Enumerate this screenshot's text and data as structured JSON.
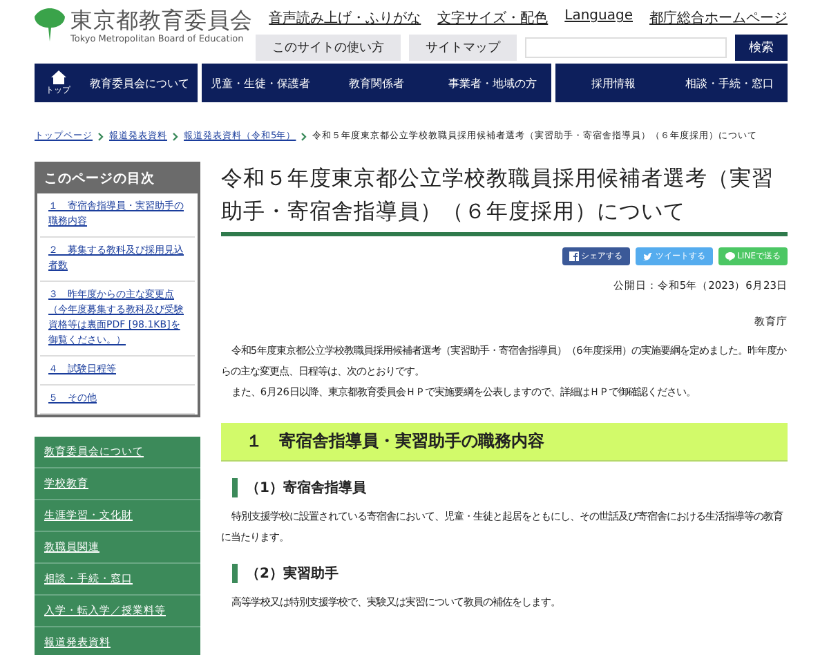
{
  "header": {
    "logo_title": "東京都教育委員会",
    "logo_subtitle": "Tokyo Metropolitan Board of Education",
    "utility_links": [
      "音声読み上げ・ふりがな",
      "文字サイズ・配色",
      "Language",
      "都庁総合ホームページ"
    ],
    "buttons": [
      "このサイトの使い方",
      "サイトマップ"
    ],
    "search_button": "検索"
  },
  "nav": {
    "home": "トップ",
    "items": [
      {
        "label": "教育委員会について",
        "divider_after": true
      },
      {
        "label": "児童・生徒・保護者",
        "divider_after": false
      },
      {
        "label": "教育関係者",
        "divider_after": false
      },
      {
        "label": "事業者・地域の方",
        "divider_after": true
      },
      {
        "label": "採用情報",
        "divider_after": false
      },
      {
        "label": "相談・手続・窓口",
        "divider_after": false
      }
    ]
  },
  "breadcrumb": {
    "links": [
      "トップページ",
      "報道発表資料",
      "報道発表資料（令和5年）"
    ],
    "current": "令和５年度東京都公立学校教職員採用候補者選考（実習助手・寄宿舎指導員）（６年度採用）について"
  },
  "toc": {
    "title": "このページの目次",
    "items": [
      "１　寄宿舎指導員・実習助手の職務内容",
      "２　募集する教科及び採用見込者数",
      "３　昨年度からの主な変更点（今年度募集する教科及び受験資格等は裏面PDF [98.1KB]を御覧ください。）",
      "４　試験日程等",
      "５　その他"
    ]
  },
  "side_menu": [
    "教育委員会について",
    "学校教育",
    "生涯学習・文化財",
    "教職員関連",
    "相談・手続・窓口",
    "入学・転入学／授業料等",
    "報道発表資料"
  ],
  "article": {
    "title": "令和５年度東京都公立学校教職員採用候補者選考（実習助手・寄宿舎指導員）（６年度採用）について",
    "share": [
      {
        "kind": "facebook",
        "label": "シェアする"
      },
      {
        "kind": "twitter",
        "label": "ツイートする"
      },
      {
        "kind": "line",
        "label": "LINEで送る"
      }
    ],
    "date": "公開日：令和5年（2023）6月23日",
    "author": "教育庁",
    "paragraphs": [
      "令和5年度東京都公立学校教職員採用候補者選考（実習助手・寄宿舎指導員）（6年度採用）の実施要綱を定めました。昨年度からの主な変更点、日程等は、次のとおりです。",
      "また、6月26日以降、東京都教育委員会ＨＰで実施要綱を公表しますので、詳細はＨＰで御確認ください。"
    ],
    "section": {
      "heading": "１　寄宿舎指導員・実習助手の職務内容",
      "subsections": [
        {
          "heading": "（1）寄宿舎指導員",
          "text": "特別支援学校に設置されている寄宿舎において、児童・生徒と起居をともにし、その世話及び寄宿舎における生活指導等の教育に当たります。"
        },
        {
          "heading": "（2）実習助手",
          "text": "高等学校又は特別支援学校で、実験又は実習について教員の補佐をします。"
        }
      ]
    }
  }
}
